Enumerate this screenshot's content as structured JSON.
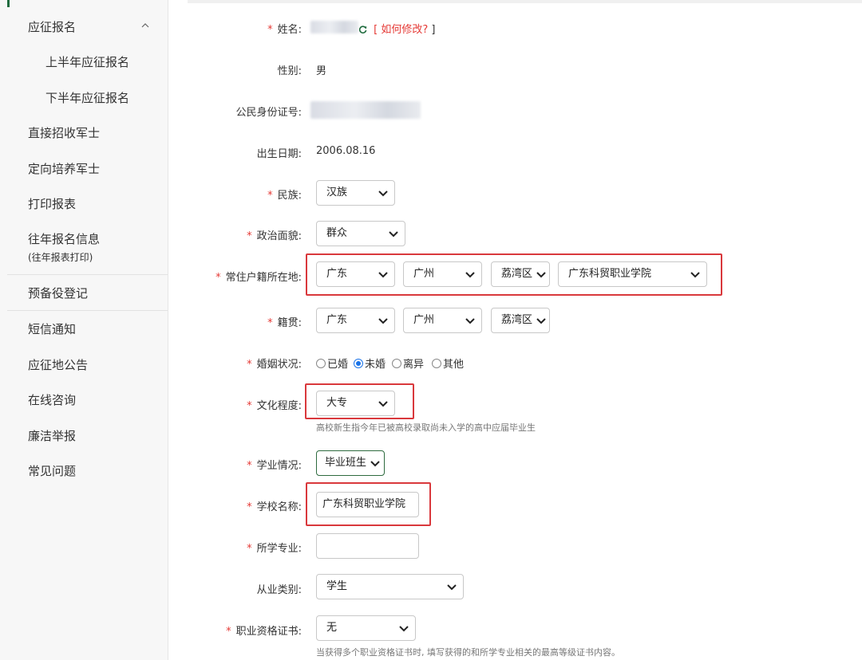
{
  "sidebar": {
    "items": [
      {
        "label": "应征报名"
      },
      {
        "label": "上半年应征报名"
      },
      {
        "label": "下半年应征报名"
      },
      {
        "label": "直接招收军士"
      },
      {
        "label": "定向培养军士"
      },
      {
        "label": "打印报表"
      },
      {
        "label": "往年报名信息",
        "sub": "(往年报表打印)"
      },
      {
        "label": "预备役登记"
      },
      {
        "label": "短信通知"
      },
      {
        "label": "应征地公告"
      },
      {
        "label": "在线咨询"
      },
      {
        "label": "廉洁举报"
      },
      {
        "label": "常见问题"
      }
    ]
  },
  "form": {
    "name": {
      "label": "姓名:",
      "link_open": "[",
      "link_text": "如何修改?",
      "link_close": "]"
    },
    "gender": {
      "label": "性别:",
      "value": "男"
    },
    "id_number": {
      "label": "公民身份证号:"
    },
    "birth": {
      "label": "出生日期:",
      "value": "2006.08.16"
    },
    "ethnicity": {
      "label": "民族:",
      "value": "汉族"
    },
    "political": {
      "label": "政治面貌:",
      "value": "群众"
    },
    "household": {
      "label": "常住户籍所在地:",
      "province": "广东",
      "city": "广州",
      "district": "荔湾区",
      "school": "广东科贸职业学院"
    },
    "native": {
      "label": "籍贯:",
      "province": "广东",
      "city": "广州",
      "district": "荔湾区"
    },
    "marital": {
      "label": "婚姻状况:",
      "options": [
        "已婚",
        "未婚",
        "离异",
        "其他"
      ],
      "selected": "未婚"
    },
    "education": {
      "label": "文化程度:",
      "value": "大专",
      "hint": "高校新生指今年已被高校录取尚未入学的高中应届毕业生"
    },
    "study_status": {
      "label": "学业情况:",
      "value": "毕业班生"
    },
    "school_name": {
      "label": "学校名称:",
      "value": "广东科贸职业学院"
    },
    "major": {
      "label": "所学专业:",
      "value": ""
    },
    "occupation": {
      "label": "从业类别:",
      "value": "学生"
    },
    "certificate": {
      "label": "职业资格证书:",
      "value": "无",
      "hint": "当获得多个职业资格证书时, 填写获得的和所学专业相关的最高等级证书内容。"
    }
  },
  "colors": {
    "required": "#e53935",
    "highlight": "#d9383c",
    "accent": "#1f6b3e",
    "radio": "#1a73e8"
  }
}
